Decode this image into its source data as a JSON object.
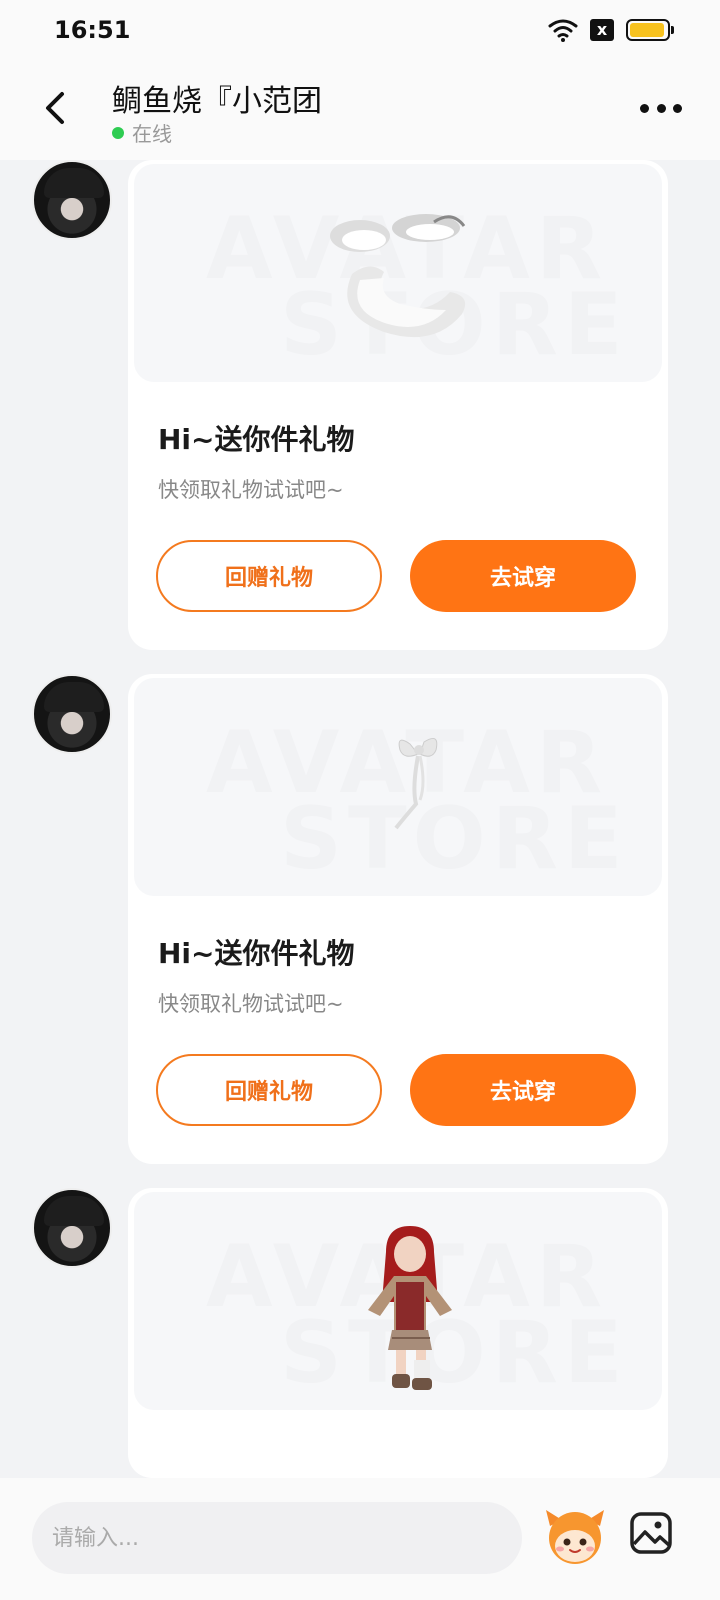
{
  "status_bar": {
    "time": "16:51",
    "sim_label": "x",
    "battery_level": 0.95,
    "battery_color": "#f7c21f"
  },
  "header": {
    "title": "鲷鱼烧『小范团",
    "status": "在线",
    "status_color": "#2ecc52"
  },
  "messages": [
    {
      "preview_watermark_line1": "AVATAR",
      "preview_watermark_line2": "STORE",
      "item_icon": "fluffy-white-wings-icon",
      "title": "Hi~送你件礼物",
      "subtitle": "快领取礼物试试吧~",
      "secondary_button": "回赠礼物",
      "primary_button": "去试穿"
    },
    {
      "preview_watermark_line1": "AVATAR",
      "preview_watermark_line2": "STORE",
      "item_icon": "ribbon-bow-icon",
      "title": "Hi~送你件礼物",
      "subtitle": "快领取礼物试试吧~",
      "secondary_button": "回赠礼物",
      "primary_button": "去试穿"
    },
    {
      "preview_watermark_line1": "AVATAR",
      "preview_watermark_line2": "STORE",
      "item_icon": "avatar-character-icon"
    }
  ],
  "input": {
    "placeholder": "请输入..."
  },
  "colors": {
    "accent": "#ff7414",
    "accent_outline": "#f47a1f",
    "background": "#f2f3f5"
  }
}
